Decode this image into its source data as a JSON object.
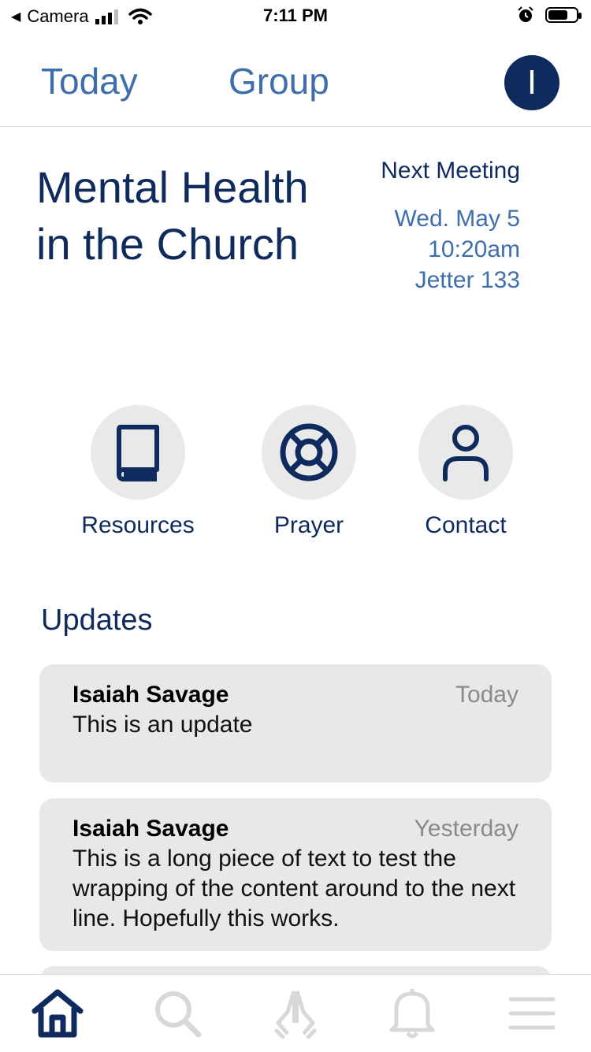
{
  "status_bar": {
    "back_label": "Camera",
    "time": "7:11 PM"
  },
  "nav": {
    "tab_today": "Today",
    "tab_group": "Group",
    "avatar_initial": "I"
  },
  "group": {
    "title": "Mental Health in the Church",
    "next_meeting_label": "Next Meeting",
    "meeting_date": "Wed. May 5",
    "meeting_time": "10:20am",
    "meeting_location": "Jetter 133"
  },
  "actions": [
    {
      "label": "Resources",
      "icon": "book-icon"
    },
    {
      "label": "Prayer",
      "icon": "lifebuoy-icon"
    },
    {
      "label": "Contact",
      "icon": "person-icon"
    }
  ],
  "updates": {
    "heading": "Updates",
    "items": [
      {
        "author": "Isaiah Savage",
        "time": "Today",
        "text": "This is an update"
      },
      {
        "author": "Isaiah Savage",
        "time": "Yesterday",
        "text": "This is a long piece of text to test the wrapping of the content around to the next line. Hopefully this works."
      }
    ]
  },
  "bottom_nav": {
    "items": [
      "home-icon",
      "search-icon",
      "praying-hands-icon",
      "bell-icon",
      "menu-icon"
    ],
    "active": "home-icon"
  },
  "colors": {
    "navy": "#0f2a5c",
    "link_blue": "#3e6eab",
    "card_bg": "#e8e8e8",
    "inactive_icon": "#d8d8d8"
  }
}
